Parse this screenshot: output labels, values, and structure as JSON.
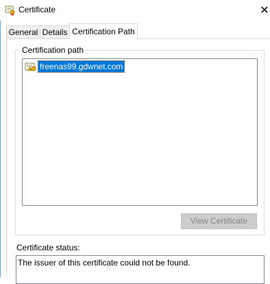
{
  "window": {
    "title": "Certificate"
  },
  "tabs": [
    {
      "label": "General",
      "active": false
    },
    {
      "label": "Details",
      "active": false
    },
    {
      "label": "Certification Path",
      "active": true
    }
  ],
  "certification_path": {
    "group_label": "Certification path",
    "items": [
      {
        "label": "freenas99.gdwnet.com",
        "selected": true,
        "icon": "certificate-warning-icon"
      }
    ],
    "view_button_label": "View Certificate",
    "view_button_enabled": false
  },
  "status": {
    "label": "Certificate status:",
    "text": "The issuer of this certificate could not be found."
  },
  "colors": {
    "selection": "#0078d7",
    "disabled_button_bg": "#cccccc",
    "disabled_button_text": "#838383"
  }
}
